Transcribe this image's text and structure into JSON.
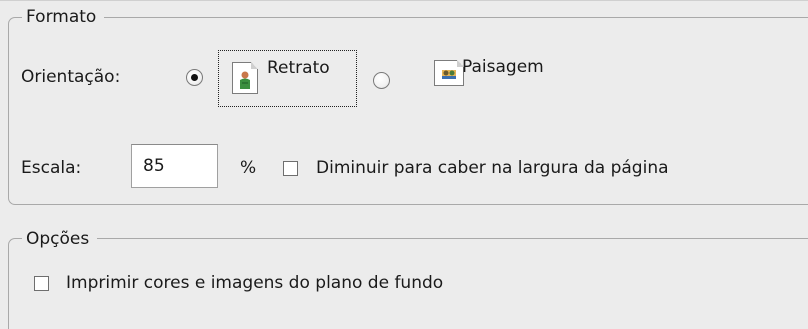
{
  "formato": {
    "title": "Formato",
    "orientation_label": "Orientação:",
    "options": [
      {
        "label": "Retrato",
        "selected": true,
        "icon": "portrait-page-icon"
      },
      {
        "label": "Paisagem",
        "selected": false,
        "icon": "landscape-page-icon"
      }
    ],
    "scale_label": "Escala:",
    "scale_value": "85",
    "scale_unit": "%",
    "shrink_to_fit_label": "Diminuir para caber na largura da página",
    "shrink_to_fit_checked": false
  },
  "opcoes": {
    "title": "Opções",
    "print_background_label": "Imprimir cores e imagens do plano de fundo",
    "print_background_checked": false
  }
}
